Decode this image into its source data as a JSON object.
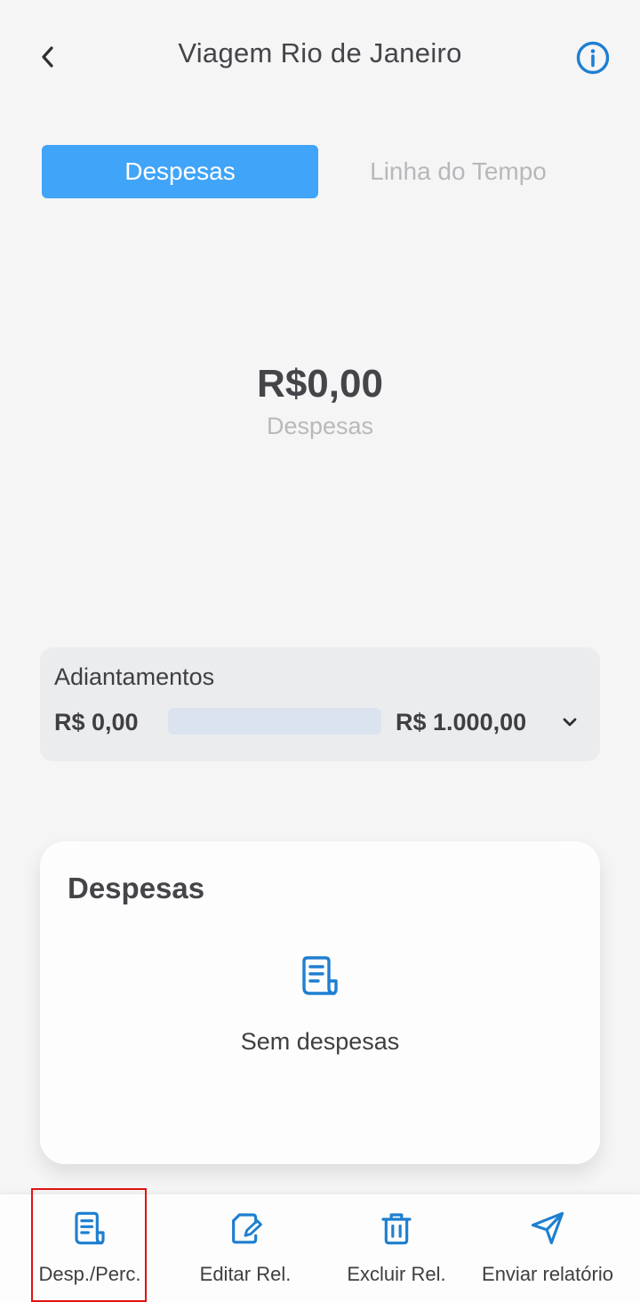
{
  "header": {
    "title": "Viagem Rio de Janeiro",
    "back_icon": "chevron-left-icon",
    "info_icon": "info-circle-icon"
  },
  "tabs": [
    {
      "label": "Despesas",
      "active": true
    },
    {
      "label": "Linha do Tempo",
      "active": false
    }
  ],
  "summary": {
    "amount": "R$0,00",
    "label": "Despesas"
  },
  "advances": {
    "title": "Adiantamentos",
    "used": "R$ 0,00",
    "limit": "R$ 1.000,00",
    "progress_fraction": 0,
    "expand_icon": "chevron-down-icon"
  },
  "expenses": {
    "title": "Despesas",
    "empty_icon": "receipt-icon",
    "empty_text": "Sem despesas"
  },
  "bottom_nav": [
    {
      "label": "Desp./Perc.",
      "icon": "receipt-icon"
    },
    {
      "label": "Editar Rel.",
      "icon": "edit-icon"
    },
    {
      "label": "Excluir Rel.",
      "icon": "trash-icon"
    },
    {
      "label": "Enviar relatório",
      "icon": "send-icon"
    }
  ],
  "colors": {
    "accent": "#40a4f9",
    "icon_blue": "#1e7fd0",
    "highlight_border": "#e01212",
    "background": "#f5f5f6"
  }
}
